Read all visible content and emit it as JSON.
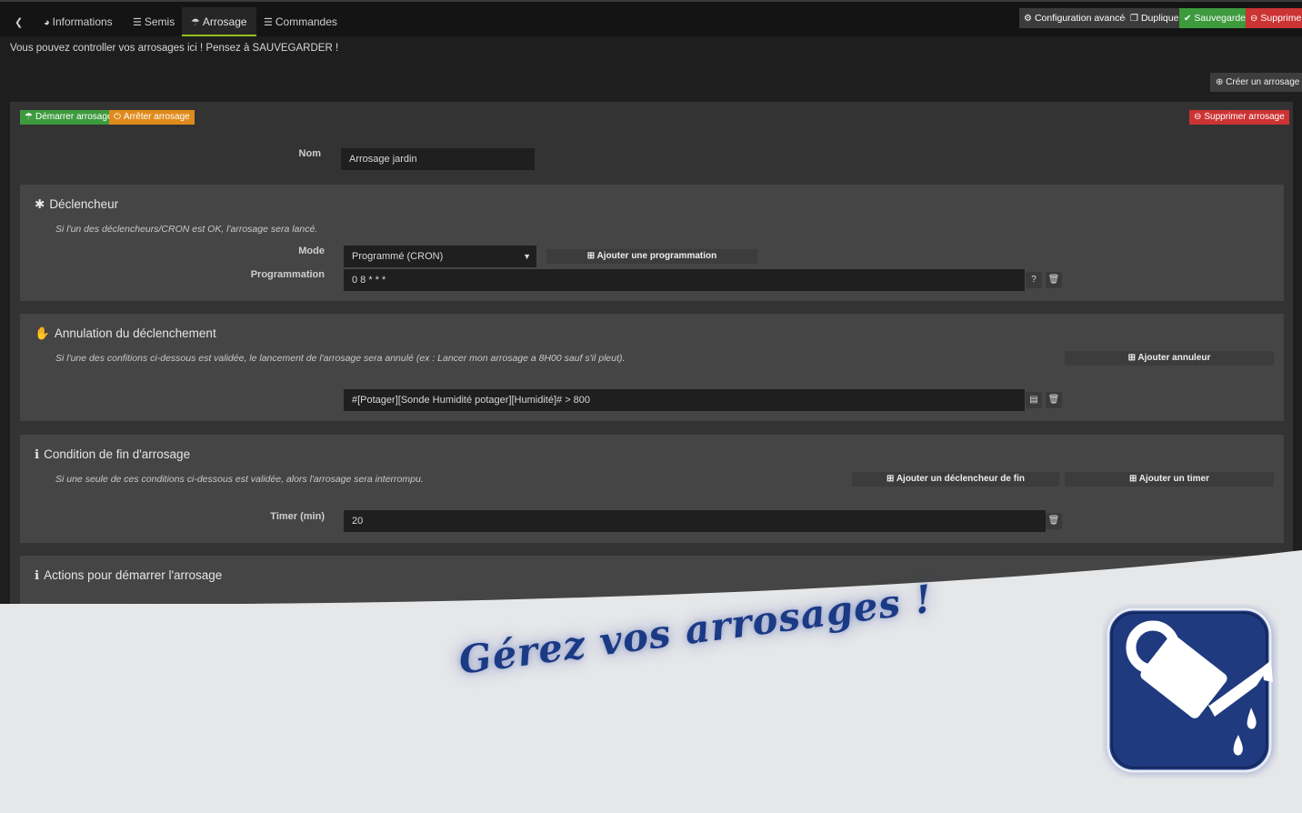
{
  "tabs": [
    {
      "icon": "back-icon",
      "label": ""
    },
    {
      "icon": "dashboard-icon",
      "label": "Informations"
    },
    {
      "icon": "list-icon",
      "label": "Semis"
    },
    {
      "icon": "watering-can-icon",
      "label": "Arrosage"
    },
    {
      "icon": "list-icon",
      "label": "Commandes"
    }
  ],
  "header_buttons": {
    "advanced_config": "Configuration avancée",
    "duplicate": "Dupliquer",
    "save": "Sauvegarder",
    "delete": "Supprimer"
  },
  "info_text": "Vous pouvez controller vos arrosages ici ! Pensez à SAUVEGARDER !",
  "create_button": "Créer un arrosage",
  "watering": {
    "start_button": "Démarrer arrosage",
    "stop_button": "Arrêter arrosage",
    "delete_button": "Supprimer arrosage",
    "name_label": "Nom",
    "name_value": "Arrosage jardin"
  },
  "trigger": {
    "title": "Déclencheur",
    "description": "Si l'un des déclencheurs/CRON est OK, l'arrosage sera lancé.",
    "mode_label": "Mode",
    "mode_value": "Programmé (CRON)",
    "add_schedule_button": "Ajouter une programmation",
    "schedule_label": "Programmation",
    "schedule_value": "0 8 * * *"
  },
  "cancel": {
    "title": "Annulation du déclenchement",
    "description": "Si l'une des confitions ci-dessous est validée, le lancement de l'arrosage sera annulé (ex : Lancer mon arrosage a 8H00 sauf s'il pleut).",
    "add_button": "Ajouter annuleur",
    "condition_value": "#[Potager][Sonde Humidité potager][Humidité]# > 800"
  },
  "end_condition": {
    "title": "Condition de fin d'arrosage",
    "description": "Si une seule de ces conditions ci-dessous est validée, alors l'arrosage sera interrompu.",
    "add_end_trigger_button": "Ajouter un déclencheur de fin",
    "add_timer_button": "Ajouter un timer",
    "timer_label": "Timer (min)",
    "timer_value": "20"
  },
  "actions": {
    "title": "Actions pour démarrer l'arrosage"
  },
  "promo": {
    "slogan": "Gérez vos arrosages !"
  },
  "colors": {
    "green": "#3d9a3d",
    "orange": "#e08a1c",
    "red": "#cc3333",
    "accent_tab": "#95c11f",
    "logo_blue": "#1b3a85"
  }
}
